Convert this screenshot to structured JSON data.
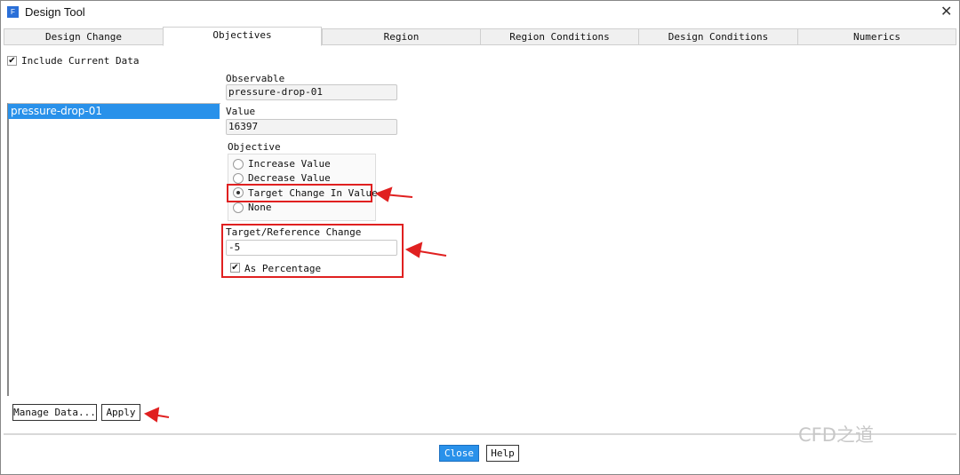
{
  "window": {
    "title": "Design Tool",
    "app_icon": "F"
  },
  "tabs": [
    "Design Change",
    "Objectives",
    "Region",
    "Region Conditions",
    "Design Conditions",
    "Numerics"
  ],
  "include_current_data": {
    "label": "Include Current Data",
    "checked": true
  },
  "list": {
    "items": [
      "pressure-drop-01"
    ],
    "selected": "pressure-drop-01"
  },
  "observable": {
    "label": "Observable",
    "value": "pressure-drop-01"
  },
  "value": {
    "label": "Value",
    "value": "16397"
  },
  "objective": {
    "label": "Objective",
    "options": [
      "Increase Value",
      "Decrease Value",
      "Target Change In Value",
      "None"
    ],
    "selected": "Target Change In Value"
  },
  "target": {
    "label": "Target/Reference Change",
    "value": "-5",
    "as_percentage_label": "As Percentage",
    "as_percentage": true
  },
  "buttons": {
    "manage": "Manage Data...",
    "apply": "Apply",
    "close": "Close",
    "help": "Help"
  },
  "watermark": "CFD之道",
  "colors": {
    "accent": "#2991ea",
    "annotation": "#e02020"
  }
}
